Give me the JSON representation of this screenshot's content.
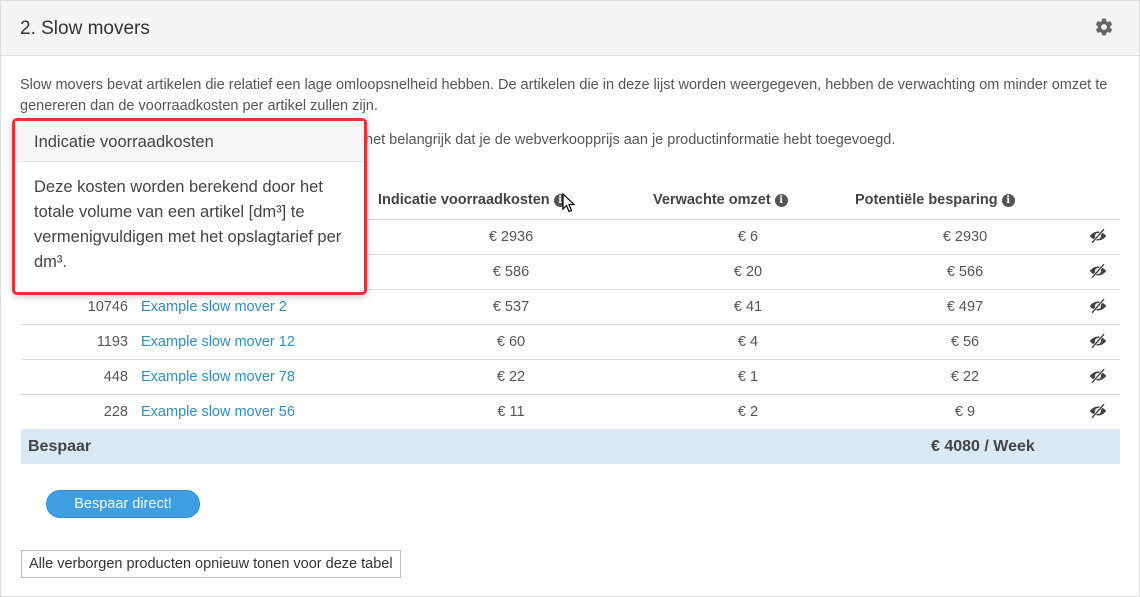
{
  "panel": {
    "title": "2. Slow movers",
    "description": "Slow movers bevat artikelen die relatief een lage omloopsnelheid hebben. De artikelen die in deze lijst worden weergegeven, hebben de verwachting om minder omzet te genereren dan de voorraadkosten per artikel zullen zijn.",
    "note_visible": "het belangrijk dat je de webverkoopprijs aan je productinformatie hebt toegevoegd."
  },
  "table": {
    "headers": {
      "cost": "Indicatie voorraadkosten",
      "revenue": "Verwachte omzet",
      "saving": "Potentiële besparing"
    },
    "rows": [
      {
        "num": "",
        "name": "",
        "cost": "€ 2936",
        "revenue": "€ 6",
        "saving": "€ 2930"
      },
      {
        "num": "",
        "name": "",
        "cost": "€ 586",
        "revenue": "€ 20",
        "saving": "€ 566"
      },
      {
        "num": "10746",
        "name": "Example slow mover 2",
        "cost": "€ 537",
        "revenue": "€ 41",
        "saving": "€ 497"
      },
      {
        "num": "1193",
        "name": "Example slow mover 12",
        "cost": "€ 60",
        "revenue": "€ 4",
        "saving": "€ 56"
      },
      {
        "num": "448",
        "name": "Example slow mover 78",
        "cost": "€ 22",
        "revenue": "€ 1",
        "saving": "€ 22"
      },
      {
        "num": "228",
        "name": "Example slow mover 56",
        "cost": "€ 11",
        "revenue": "€ 2",
        "saving": "€ 9"
      }
    ],
    "total": {
      "label": "Bespaar",
      "value": "€ 4080 / Week"
    }
  },
  "actions": {
    "save_now": "Bespaar direct!",
    "show_hidden": "Alle verborgen producten opnieuw tonen voor deze tabel"
  },
  "tooltip": {
    "title": "Indicatie voorraadkosten",
    "body": "Deze kosten worden berekend door het totale volume van een artikel [dm³] te vermenigvuldigen met het opslagtarief per dm³."
  },
  "icons": {
    "settings": "gear-icon",
    "info": "info-icon",
    "hide": "eye-slash-icon",
    "pointer": "mouse-cursor-icon"
  },
  "colors": {
    "link": "#2f8fbf",
    "total_bg": "#d9e9f5",
    "button": "#3d9ee2",
    "tooltip_border": "#e23434"
  }
}
